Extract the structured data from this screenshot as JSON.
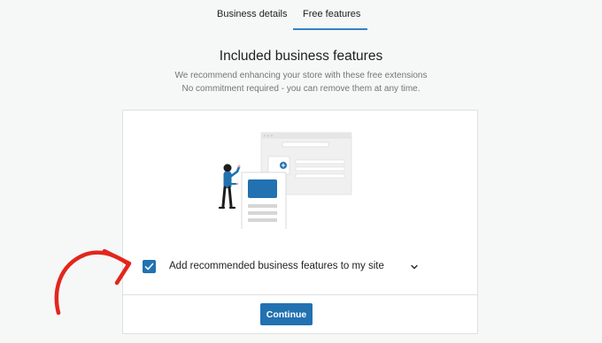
{
  "tabs": {
    "business_details": "Business details",
    "free_features": "Free features",
    "active": "Free features"
  },
  "header": {
    "title": "Included business features",
    "subtitle_line1": "We recommend enhancing your store with these free extensions",
    "subtitle_line2": "No commitment required - you can remove them at any time."
  },
  "card": {
    "illustration_icon": "store-features-illustration",
    "option_label": "Add recommended business features to my site",
    "option_checked": true,
    "continue_label": "Continue"
  },
  "colors": {
    "accent": "#2271b1",
    "tab_underline": "#3582c4",
    "annotation_arrow": "#e2261d",
    "background": "#f6f7f7"
  }
}
